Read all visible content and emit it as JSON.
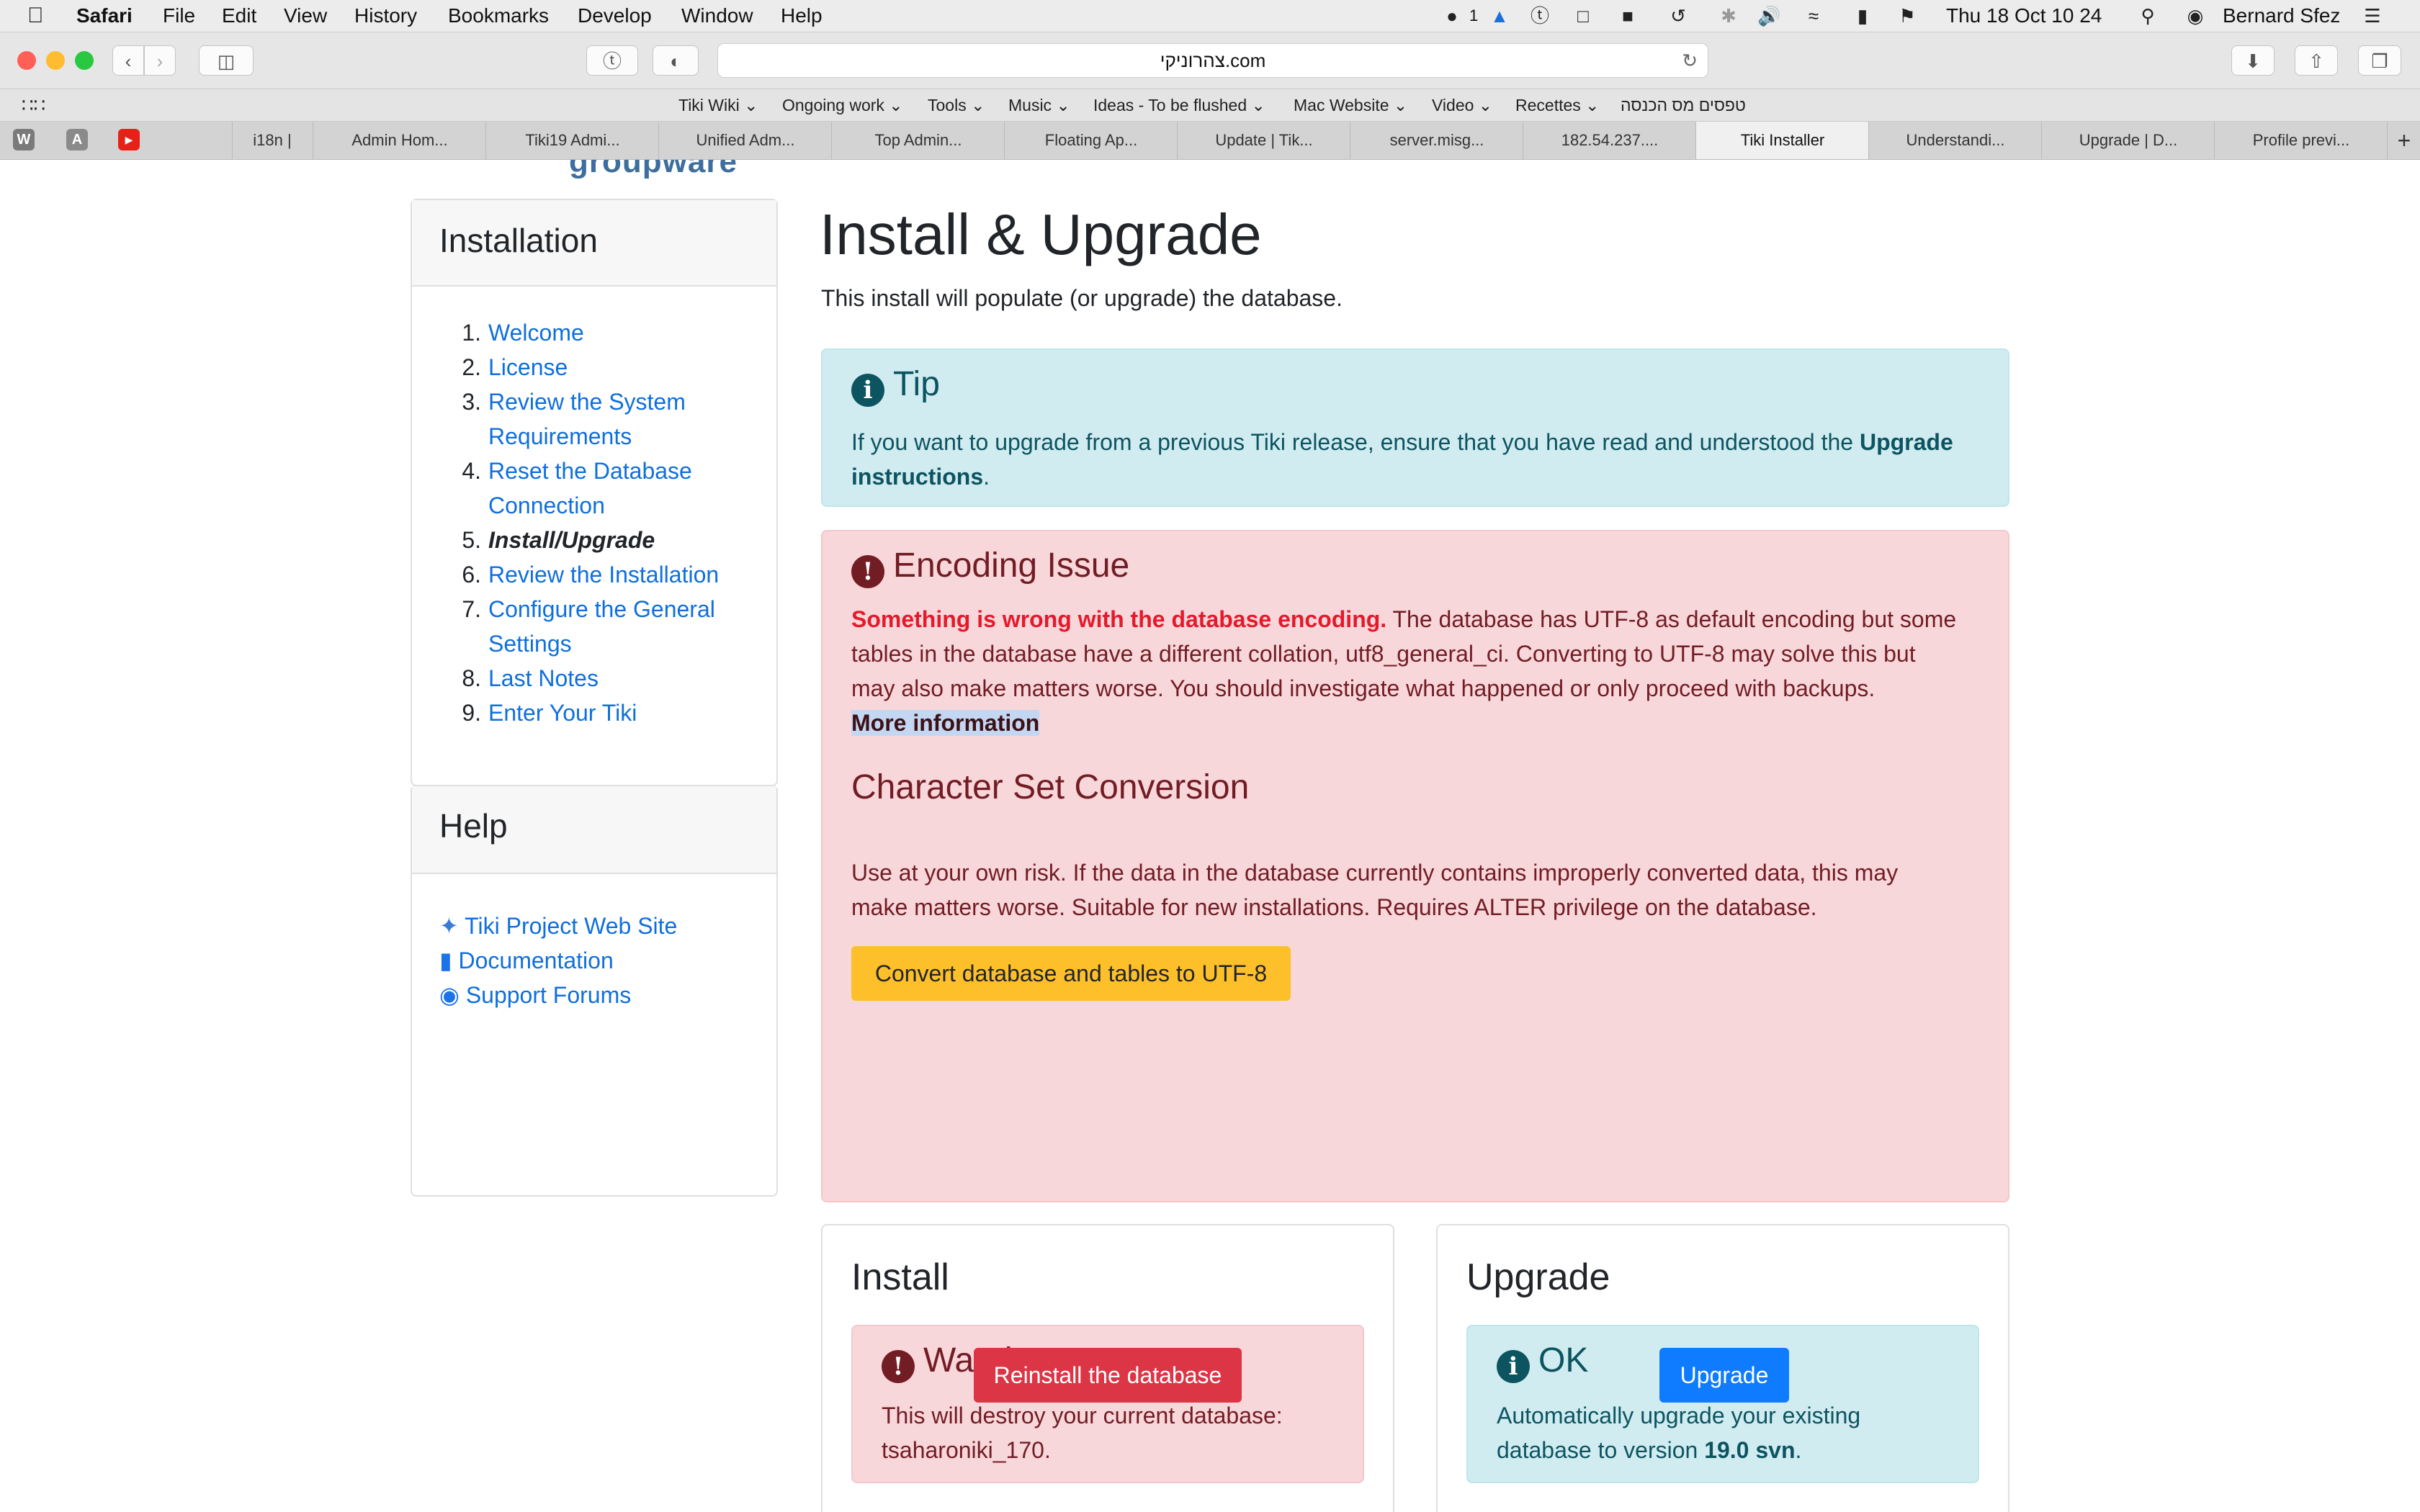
{
  "menubar": {
    "app": "Safari",
    "items": [
      "File",
      "Edit",
      "View",
      "History",
      "Bookmarks",
      "Develop",
      "Window",
      "Help"
    ],
    "status": {
      "notif_count": "1",
      "datetime": "Thu 18 Oct  10 24",
      "user": "Bernard Sfez"
    }
  },
  "toolbar": {
    "url": "צהרוניקי.com"
  },
  "bookmarks": [
    "Tiki Wiki",
    "Ongoing work",
    "Tools",
    "Music",
    "Ideas - To be flushed",
    "Mac Website",
    "Video",
    "Recettes",
    "טפסים מס הכנסה"
  ],
  "tabs": {
    "pinned": [
      "W",
      "A",
      "▶"
    ],
    "items": [
      "i18n |",
      "Admin Hom...",
      "Tiki19 Admi...",
      "Unified Adm...",
      "Top Admin...",
      "Floating Ap...",
      "Update | Tik...",
      "server.misg...",
      "182.54.237....",
      "Tiki Installer",
      "Understandi...",
      "Upgrade | D...",
      "Profile previ..."
    ],
    "active_index": 9
  },
  "page": {
    "logo_fragment": "groupware",
    "sidebar": {
      "installation_title": "Installation",
      "steps": [
        {
          "n": "1.",
          "label": "Welcome"
        },
        {
          "n": "2.",
          "label": "License"
        },
        {
          "n": "3.",
          "label": "Review the System",
          "label2": "Requirements"
        },
        {
          "n": "4.",
          "label": "Reset the Database",
          "label2": "Connection"
        },
        {
          "n": "5.",
          "label": "Install/Upgrade"
        },
        {
          "n": "6.",
          "label": "Review the Installation"
        },
        {
          "n": "7.",
          "label": "Configure the General",
          "label2": "Settings"
        },
        {
          "n": "8.",
          "label": "Last Notes"
        },
        {
          "n": "9.",
          "label": "Enter Your Tiki"
        }
      ],
      "help_title": "Help",
      "help_links": [
        "Tiki Project Web Site",
        "Documentation",
        "Support Forums"
      ]
    },
    "main": {
      "title": "Install & Upgrade",
      "intro": "This install will populate (or upgrade) the database.",
      "tip": {
        "title": "Tip",
        "text": "If you want to upgrade from a previous Tiki release, ensure that you have read and understood the",
        "strong": "Upgrade",
        "strong2": "instructions",
        "end": "."
      },
      "encoding": {
        "title": "Encoding Issue",
        "strong": "Something is wrong with the database encoding.",
        "line1": "The database has UTF-8 as default encoding but some",
        "line2": "tables in the database have a different collation, utf8_general_ci. Converting to UTF-8 may solve this but",
        "line3": "may also make matters worse. You should investigate what happened or only proceed with backups.",
        "more": "More information",
        "conv_title": "Character Set Conversion",
        "conv_line1": "Use at your own risk. If the data in the database currently contains improperly converted data, this may",
        "conv_line2": "make matters worse. Suitable for new installations. Requires ALTER privilege on the database.",
        "button": "Convert database and tables to UTF-8"
      },
      "install": {
        "title": "Install",
        "warning_title": "Warning",
        "warning_line1": "This will destroy your current database:",
        "warning_line2": "tsaharoniki_170.",
        "button": "Reinstall the database"
      },
      "upgrade": {
        "title": "Upgrade",
        "ok_title": "OK",
        "ok_line1": "Automatically upgrade your existing",
        "ok_line2a": "database to version",
        "ok_version": "19.0 svn",
        "ok_line2b": ".",
        "button": "Upgrade"
      }
    }
  },
  "colors": {
    "link": "#0f6fdc",
    "info_bg": "#d1ecf1",
    "danger_bg": "#f8d7da",
    "danger_text": "#721c24",
    "danger_strong": "#e5192c",
    "warning_btn": "#fec02a",
    "danger_btn": "#dc3545",
    "primary_btn": "#0f7bff"
  }
}
